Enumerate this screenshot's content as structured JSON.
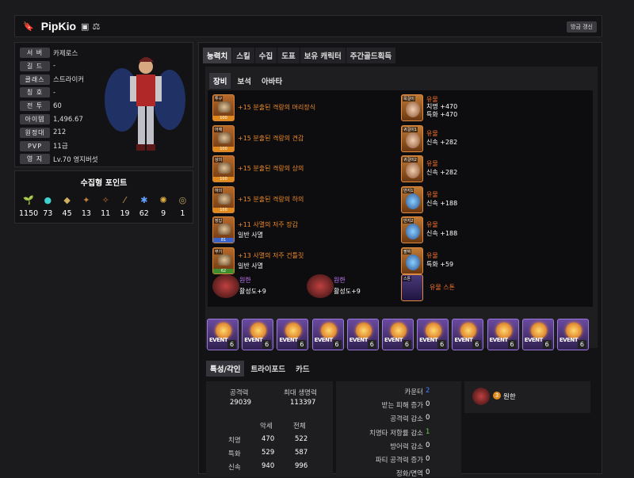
{
  "header": {
    "name": "PipKio",
    "refresh_label": "방금 갱신"
  },
  "info": [
    {
      "label": "서 버",
      "value": "카제로스"
    },
    {
      "label": "길 드",
      "value": "-"
    },
    {
      "label": "클래스",
      "value": "스트라이커"
    },
    {
      "label": "칭 호",
      "value": "-"
    },
    {
      "label": "전 투",
      "value": "60"
    },
    {
      "label": "아이템",
      "value": "1,496.67"
    },
    {
      "label": "원정대",
      "value": "212"
    },
    {
      "label": "PVP",
      "value": "11급"
    },
    {
      "label": "영 지",
      "value": "Lv.70 영지버섯"
    }
  ],
  "collect": {
    "title": "수집형 포인트",
    "values": [
      "1150",
      "73",
      "45",
      "13",
      "11",
      "19",
      "62",
      "9",
      "1"
    ]
  },
  "tabs": [
    "능력치",
    "스킬",
    "수집",
    "도표",
    "보유 캐릭터",
    "주간골드획득"
  ],
  "subtabs": [
    "장비",
    "보석",
    "아바타"
  ],
  "equip": [
    {
      "slot": "투구",
      "quality": "100",
      "name": "+15 분출된 격랑의 머리장식"
    },
    {
      "slot": "어깨",
      "quality": "100",
      "name": "+15 분출된 격랑의 견갑"
    },
    {
      "slot": "상의",
      "quality": "100",
      "name": "+15 분출된 격랑의 상의"
    },
    {
      "slot": "하의",
      "quality": "100",
      "name": "+15 분출된 격랑의 하의"
    },
    {
      "slot": "장갑",
      "quality": "81",
      "name": "+11 사멸의 저주 장갑",
      "set": "일반 사멸"
    },
    {
      "slot": "무기",
      "quality": "62",
      "name": "+13 사멸의 저주 건틀릿",
      "set": "일반 사멸"
    }
  ],
  "acc": [
    {
      "slot": "목걸이",
      "grade": "유물",
      "l1": "치명 +470",
      "l2": "특화 +470"
    },
    {
      "slot": "귀걸이1",
      "grade": "유물",
      "l1": "신속 +282",
      "l2": ""
    },
    {
      "slot": "귀걸이2",
      "grade": "유물",
      "l1": "신속 +282",
      "l2": ""
    },
    {
      "slot": "반지1",
      "grade": "유물",
      "l1": "신속 +188",
      "l2": ""
    },
    {
      "slot": "반지2",
      "grade": "유물",
      "l1": "신속 +188",
      "l2": ""
    },
    {
      "slot": "팔찌",
      "grade": "유물",
      "l1": "특화 +59",
      "l2": ""
    }
  ],
  "gems": [
    {
      "name": "원한",
      "level": "활성도+9"
    },
    {
      "name": "원한",
      "level": "활성도+9"
    }
  ],
  "stone": {
    "slot": "스톤",
    "name": "유물 스톤"
  },
  "events": {
    "label": "EVENT",
    "count": "6",
    "n": 11
  },
  "bottom_tabs": [
    "특성/각인",
    "트라이포드",
    "카드"
  ],
  "stats": {
    "attack_label": "공격력",
    "attack": "29039",
    "hp_label": "최대 생명력",
    "hp": "113397",
    "col1": "악세",
    "col2": "전체",
    "rows": [
      {
        "k": "치명",
        "a": "470",
        "b": "522"
      },
      {
        "k": "특화",
        "a": "529",
        "b": "587"
      },
      {
        "k": "신속",
        "a": "940",
        "b": "996"
      }
    ]
  },
  "engr": [
    {
      "k": "카운터",
      "v": "2"
    },
    {
      "k": "받는 피해 증가",
      "v": "0"
    },
    {
      "k": "공격력 감소",
      "v": "0"
    },
    {
      "k": "치명타 저항률 감소",
      "v": "1"
    },
    {
      "k": "방어력 감소",
      "v": "0"
    },
    {
      "k": "파티 공격력 증가",
      "v": "0"
    },
    {
      "k": "정화/면역",
      "v": "0"
    }
  ],
  "engrave": {
    "level": "3",
    "name": "원한"
  },
  "colors": {
    "orange": "#f08a2a",
    "relic": "#f4702a",
    "purple": "#c77bff",
    "blue": "#3e82ff"
  }
}
